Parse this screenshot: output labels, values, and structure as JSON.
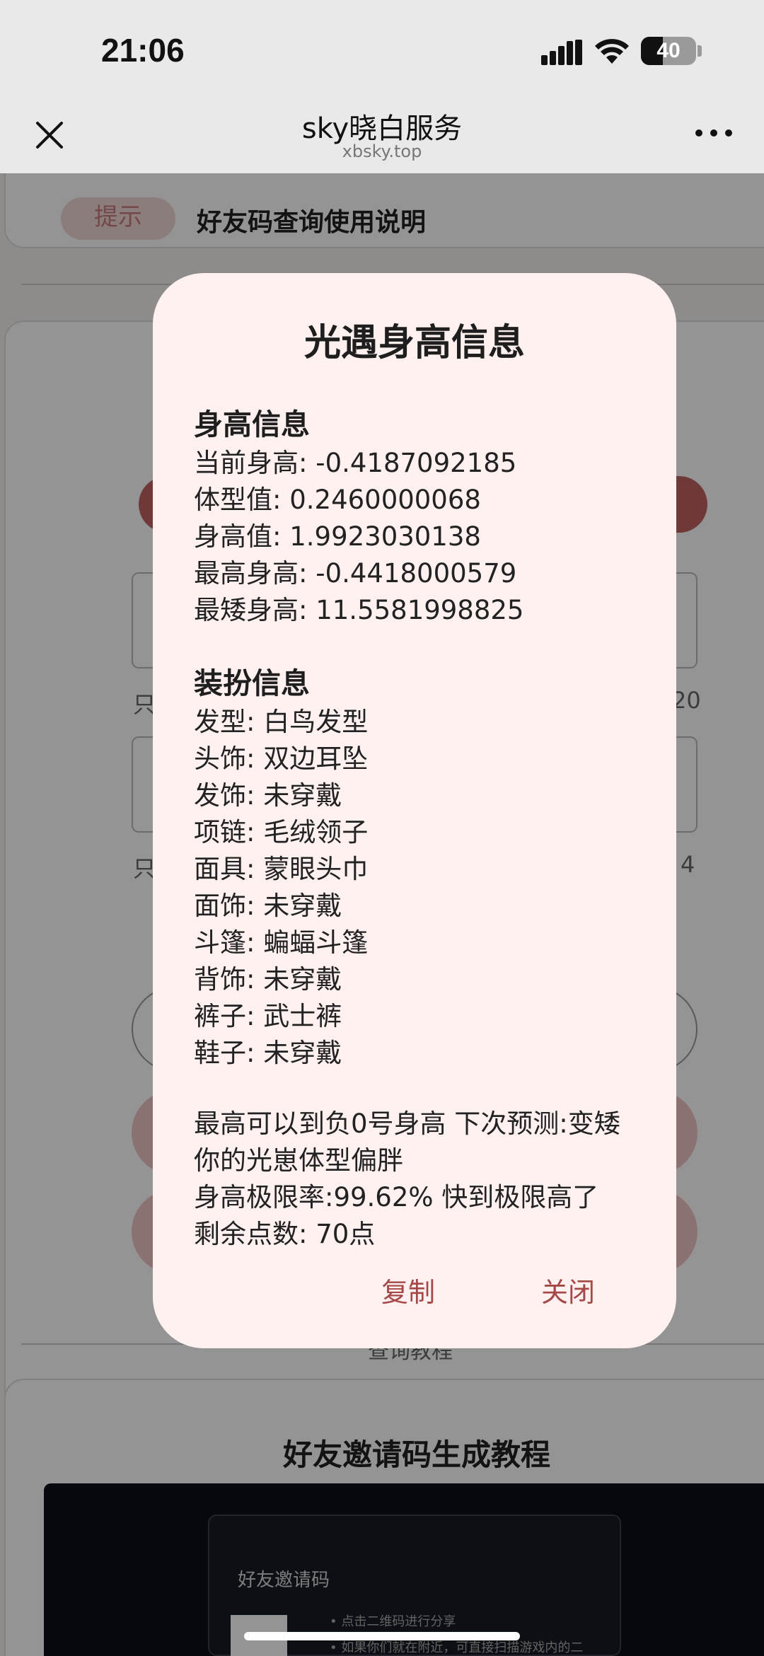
{
  "status_bar": {
    "time": "21:06",
    "battery": "40",
    "battery_level": 0.4
  },
  "nav": {
    "title": "sky晓白服务",
    "subtitle": "xbsky.top"
  },
  "background": {
    "tip_badge": "提示",
    "tip_text": "好友码查询使用说明",
    "hint_suffix_1": "20",
    "hint_suffix_2": "4",
    "hint_prefix": "只",
    "tutorial_label": "查询教程",
    "tutorial_heading": "好友邀请码生成教程",
    "video": {
      "title": "好友邀请码",
      "line1": "• 点击二维码进行分享",
      "line2": "• 如果你们就在附近，可直接扫描游戏内的二"
    }
  },
  "dialog": {
    "title": "光遇身高信息",
    "height_section": {
      "heading": "身高信息",
      "lines": [
        "当前身高: -0.4187092185",
        "体型值: 0.2460000068",
        "身高值: 1.9923030138",
        "最高身高: -0.4418000579",
        "最矮身高: 11.5581998825"
      ]
    },
    "outfit_section": {
      "heading": "装扮信息",
      "lines": [
        "发型: 白鸟发型",
        "头饰: 双边耳坠",
        "发饰: 未穿戴",
        "项链: 毛绒领子",
        "面具: 蒙眼头巾",
        "面饰: 未穿戴",
        "斗篷: 蝙蝠斗篷",
        "背饰: 未穿戴",
        "裤子: 武士裤",
        "鞋子: 未穿戴"
      ]
    },
    "summary_lines": [
      "最高可以到负0号身高 下次预测:变矮",
      "你的光崽体型偏胖",
      "身高极限率:99.62% 快到极限高了",
      "剩余点数: 70点"
    ],
    "copy_label": "复制",
    "close_label": "关闭"
  }
}
